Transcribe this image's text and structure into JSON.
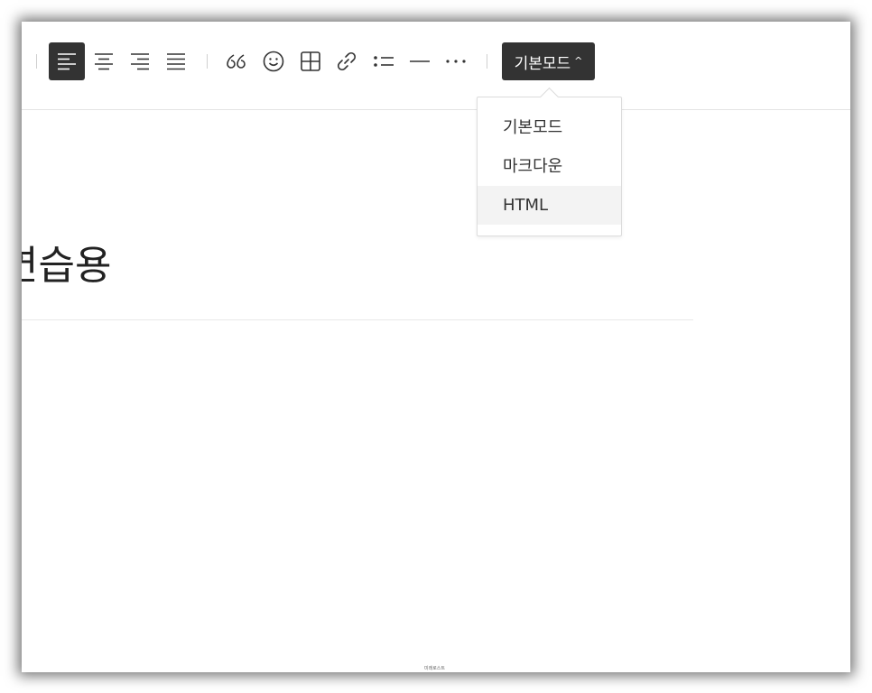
{
  "toolbar": {
    "buttons": [
      {
        "name": "align-left-button",
        "icon": "align-left-icon",
        "active": true
      },
      {
        "name": "align-center-button",
        "icon": "align-center-icon",
        "active": false
      },
      {
        "name": "align-right-button",
        "icon": "align-right-icon",
        "active": false
      },
      {
        "name": "align-justify-button",
        "icon": "align-justify-icon",
        "active": false
      },
      {
        "name": "quote-button",
        "icon": "quote-icon"
      },
      {
        "name": "emoticon-button",
        "icon": "smiley-icon"
      },
      {
        "name": "table-button",
        "icon": "table-icon"
      },
      {
        "name": "link-button",
        "icon": "link-icon"
      },
      {
        "name": "list-button",
        "icon": "bullet-list-icon"
      },
      {
        "name": "divider-button",
        "icon": "horizontal-rule-icon"
      },
      {
        "name": "more-button",
        "icon": "more-dots-icon"
      }
    ],
    "mode_label": "기본모드",
    "mode_caret": "^"
  },
  "mode_menu": {
    "items": [
      "기본모드",
      "마크다운",
      "HTML"
    ],
    "highlighted": "HTML"
  },
  "editor": {
    "title": "연습용"
  },
  "watermark": "미래로스트",
  "colors": {
    "active_bg": "#333333",
    "icon": "#333333",
    "menu_hover": "#f3f3f3"
  }
}
